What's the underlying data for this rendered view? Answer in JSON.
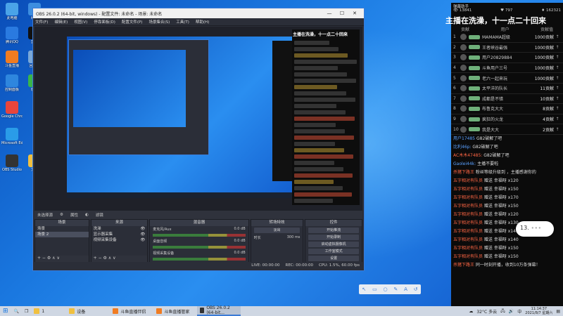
{
  "desktop": {
    "icons": [
      {
        "label": "此电脑",
        "color": "#4aa3e8"
      },
      {
        "label": "网络",
        "color": "#3d8ee0"
      },
      {
        "label": "腾讯QQ",
        "color": "#2a7ae0"
      },
      {
        "label": "剪映",
        "color": "#111111"
      },
      {
        "label": "斗鱼直播",
        "color": "#f07c22"
      },
      {
        "label": "回收站",
        "color": "#7aa8d8"
      },
      {
        "label": "控制面板",
        "color": "#2e86de"
      },
      {
        "label": "微信",
        "color": "#39b54a"
      },
      {
        "label": "Google Chrome",
        "color": "#e8453c"
      },
      {
        "label": "Microsoft Edge",
        "color": "#2a9ce8"
      },
      {
        "label": "OBS Studio",
        "color": "#333333"
      },
      {
        "label": "文件",
        "color": "#f0c040"
      }
    ]
  },
  "obs": {
    "title": "OBS 26.0.2 (64-bit, windows) - 配置文件: 未命名 - 场景: 未命名",
    "menu": [
      "文件(F)",
      "编辑(E)",
      "视图(V)",
      "停靠面板(D)",
      "配置文件(P)",
      "场景集合(S)",
      "工具(T)",
      "帮助(H)"
    ],
    "preview_banner": "主播在洗澡，十一点二十回来",
    "props_bar": {
      "no_source": "未选择源",
      "properties": "属性",
      "filters": "滤镜"
    },
    "docks": {
      "scenes": {
        "title": "场景",
        "items": [
          "场景",
          "场景 2"
        ]
      },
      "sources": {
        "title": "来源",
        "items": [
          "洗澡",
          "显示器采集",
          "视频采集设备"
        ]
      },
      "mixer": {
        "title": "混音器",
        "channels": [
          {
            "name": "麦克风/Aux",
            "db": "0.0 dB"
          },
          {
            "name": "桌面音频",
            "db": "0.0 dB"
          },
          {
            "name": "视频采集设备",
            "db": "0.0 dB"
          }
        ]
      },
      "transitions": {
        "title": "转场特效",
        "mode": "淡出",
        "duration_label": "时长",
        "duration": "300 ms"
      },
      "controls": {
        "title": "控件",
        "buttons": [
          "开始推流",
          "开始录制",
          "启动虚拟摄像机",
          "工作室模式",
          "设置",
          "退出"
        ]
      }
    },
    "status": {
      "live": "LIVE: 00:00:00",
      "rec": "REC: 00:00:00",
      "cpu": "CPU: 1.5%, 60.00 fps"
    }
  },
  "chat": {
    "app_title": "弹幕助手",
    "stats": {
      "viewers": "13841",
      "fans": "797",
      "gifts": "162321"
    },
    "banner": "主播在洗澡，十一点二十回来",
    "rank_header": {
      "col_left": "贡献",
      "col_mid": "用户",
      "col_right": "贡献值"
    },
    "ranks": [
      {
        "num": "1",
        "name": "MAMAMA超级",
        "value": "1000贡献"
      },
      {
        "num": "2",
        "name": "王者峡谷最强",
        "value": "1000贡献"
      },
      {
        "num": "3",
        "name": "用户20829884",
        "value": "1000贡献"
      },
      {
        "num": "4",
        "name": "斗鱼用户三号",
        "value": "1000贡献"
      },
      {
        "num": "5",
        "name": "老六一起来玩",
        "value": "1000贡献"
      },
      {
        "num": "6",
        "name": "太平洋的队长",
        "value": "11贡献"
      },
      {
        "num": "7",
        "name": "成都是不错",
        "value": "10贡献"
      },
      {
        "num": "8",
        "name": "布鲁克大大",
        "value": "8贡献"
      },
      {
        "num": "9",
        "name": "疯狂的火龙",
        "value": "4贡献"
      },
      {
        "num": "10",
        "name": "我是大大",
        "value": "2贡献"
      }
    ],
    "messages": [
      {
        "user": "用户17485",
        "text": "G82破解了吧",
        "style": "b"
      },
      {
        "user": "比利46p:",
        "text": "G82破解了吧",
        "style": "b"
      },
      {
        "user": "AC木木47485:",
        "text": "G82破解了吧",
        "style": "r"
      },
      {
        "user": "Gaolei44k:",
        "text": "主播不要啦",
        "style": "b"
      },
      {
        "user": "杀猪下路王",
        "text": "粉丝等级升级到 ，主播感谢你的",
        "style": "r"
      },
      {
        "user": "五字相对有队员",
        "text": "赠送 幸福呀 x120",
        "style": "r"
      },
      {
        "user": "五字相对有队员",
        "text": "赠送 幸福呀 x150",
        "style": "r"
      },
      {
        "user": "五字相对有队员",
        "text": "赠送 幸福呀 x170",
        "style": "r"
      },
      {
        "user": "五字相对有队员",
        "text": "赠送 幸福呀 x150",
        "style": "r"
      },
      {
        "user": "五字相对有队员",
        "text": "赠送 幸福呀 x120",
        "style": "r"
      },
      {
        "user": "五字相对有队员",
        "text": "赠送 幸福呀 x130",
        "style": "r"
      },
      {
        "user": "五字相对有队员",
        "text": "赠送 幸福呀 x140",
        "style": "r"
      },
      {
        "user": "五字相对有队员",
        "text": "赠送 幸福呀 x140",
        "style": "r"
      },
      {
        "user": "五字相对有队员",
        "text": "赠送 幸福呀 x150",
        "style": "r"
      },
      {
        "user": "五字相对有队员",
        "text": "赠送 幸福呀 x150",
        "style": "r"
      },
      {
        "user": "杀猪下路王",
        "text": "同一时刻开播，收到10万条弹幕！",
        "style": "r"
      }
    ]
  },
  "bubble": {
    "text": "13."
  },
  "taskbar": {
    "items": [
      {
        "label": "1",
        "color": "#f0c040"
      },
      {
        "label": "设备",
        "color": "#f0c040"
      },
      {
        "label": "斗鱼直播伴侣",
        "color": "#f07c22"
      },
      {
        "label": "斗鱼直播管家",
        "color": "#f07c22"
      },
      {
        "label": "OBS 26.0.2 (64-bit...",
        "color": "#333333"
      }
    ],
    "weather": "32°C 多云",
    "time": "11:14:37",
    "date": "2021/8/7 星期六"
  }
}
